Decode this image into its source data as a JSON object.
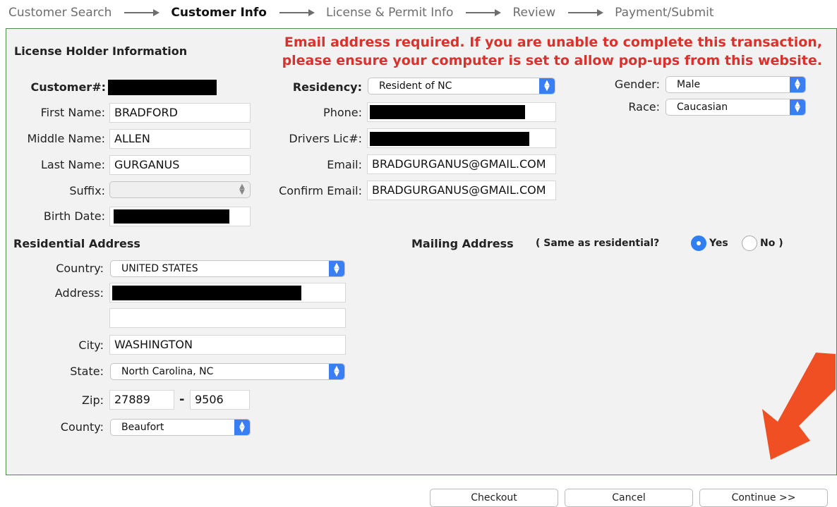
{
  "steps": [
    "Customer Search",
    "Customer Info",
    "License & Permit Info",
    "Review",
    "Payment/Submit"
  ],
  "active_step": "Customer Info",
  "error": {
    "line1": "Email address required. If you are unable to complete this transaction,",
    "line2": "please ensure your computer is set to allow pop-ups from this website."
  },
  "holder": {
    "title": "License Holder Information",
    "customer_label": "Customer#:",
    "first_label": "First Name:",
    "first_value": "BRADFORD",
    "middle_label": "Middle Name:",
    "middle_value": "ALLEN",
    "last_label": "Last Name:",
    "last_value": "GURGANUS",
    "suffix_label": "Suffix:",
    "suffix_value": "",
    "birth_label": "Birth Date:"
  },
  "contact": {
    "residency_label": "Residency:",
    "residency_value": "Resident of NC",
    "phone_label": "Phone:",
    "dl_label": "Drivers Lic#:",
    "email_label": "Email:",
    "email_value": "BRADGURGANUS@GMAIL.COM",
    "confirm_label": "Confirm Email:",
    "confirm_value": "BRADGURGANUS@GMAIL.COM"
  },
  "demographics": {
    "gender_label": "Gender:",
    "gender_value": "Male",
    "race_label": "Race:",
    "race_value": "Caucasian"
  },
  "residential": {
    "title": "Residential Address",
    "country_label": "Country:",
    "country_value": "UNITED STATES",
    "address_label": "Address:",
    "address2_value": "",
    "city_label": "City:",
    "city_value": "WASHINGTON",
    "state_label": "State:",
    "state_value": "North Carolina, NC",
    "zip_label": "Zip:",
    "zip_value": "27889",
    "zip_sep": "-",
    "zip4_value": "9506",
    "county_label": "County:",
    "county_value": "Beaufort"
  },
  "mailing": {
    "title": "Mailing Address",
    "question": "( Same as residential?",
    "yes_label": "Yes",
    "no_label": "No )",
    "selected": "Yes"
  },
  "buttons": {
    "checkout": "Checkout",
    "cancel": "Cancel",
    "continue": "Continue >>"
  },
  "colors": {
    "error": "#d9322e",
    "panel_border": "#4c8a4c",
    "select_accent": "#3a7ef4",
    "arrow": "#f04e23"
  },
  "icons": [
    "chevron-updown-icon",
    "radio-selected-icon",
    "radio-unselected-icon",
    "arrow-icon"
  ]
}
